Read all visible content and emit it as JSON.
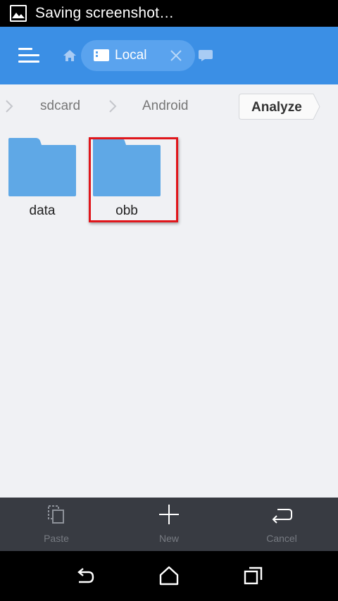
{
  "status_bar": {
    "text": "Saving screenshot…",
    "icon": "image-icon"
  },
  "app_bar": {
    "menu_icon": "menu-icon",
    "home_icon": "home-icon",
    "location_tab": {
      "label": "Local",
      "icon": "storage-icon",
      "close_icon": "close-icon"
    },
    "extra_icon": "network-icon",
    "accent_color": "#3b8fe5"
  },
  "breadcrumb": {
    "items": [
      "sdcard",
      "Android"
    ],
    "analyze_label": "Analyze"
  },
  "files": [
    {
      "name": "data",
      "type": "folder",
      "highlighted": false
    },
    {
      "name": "obb",
      "type": "folder",
      "highlighted": true
    }
  ],
  "toolbar": {
    "items": [
      {
        "label": "Paste",
        "icon": "paste-icon"
      },
      {
        "label": "New",
        "icon": "plus-icon"
      },
      {
        "label": "Cancel",
        "icon": "return-icon"
      }
    ]
  },
  "nav_bar": {
    "icons": [
      "back-icon",
      "home-icon",
      "recent-apps-icon"
    ]
  }
}
